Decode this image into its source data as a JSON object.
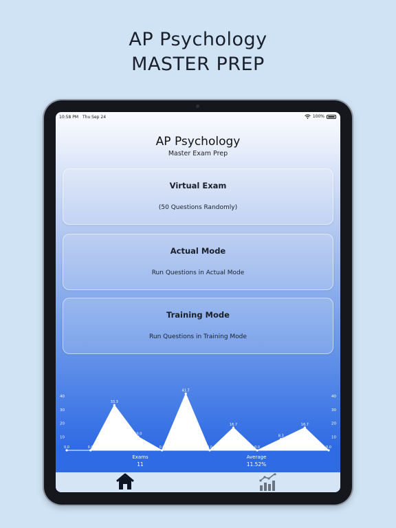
{
  "headline": {
    "line1": "AP Psychology",
    "line2": "MASTER PREP"
  },
  "status_bar": {
    "time": "10:58 PM",
    "date": "Thu Sep 24",
    "battery": "100%"
  },
  "app": {
    "title": "AP Psychology",
    "subtitle": "Master Exam Prep"
  },
  "cards": [
    {
      "title": "Virtual Exam",
      "subtitle": "(50 Questions Randomly)"
    },
    {
      "title": "Actual Mode",
      "subtitle": "Run Questions in Actual Mode"
    },
    {
      "title": "Training Mode",
      "subtitle": "Run Questions in Training Mode"
    }
  ],
  "chart_data": {
    "type": "area",
    "y_ticks": [
      10,
      20,
      30,
      40
    ],
    "ylim": [
      0,
      40
    ],
    "values": [
      0.0,
      0.0,
      33.3,
      10.0,
      0.0,
      41.7,
      0.0,
      16.7,
      0.0,
      8.3,
      16.7,
      0.0
    ],
    "labels": [
      "0.0",
      "0.0",
      "33.3",
      "10.0",
      "0.0",
      "41.7",
      "0.0",
      "16.7",
      "0.0",
      "8.3",
      "16.7",
      "0.0"
    ],
    "fill_color": "#ffffff",
    "grid": false
  },
  "summary": {
    "exams_label": "Exams",
    "exams_value": "11",
    "average_label": "Average",
    "average_value": "11.52%"
  },
  "tabs": [
    {
      "icon": "home-icon",
      "active": true
    },
    {
      "icon": "stats-icon",
      "active": false
    }
  ],
  "colors": {
    "background": "#cfe3f5",
    "accent": "#2f6be4",
    "tabbar": "#d6e5f5"
  }
}
